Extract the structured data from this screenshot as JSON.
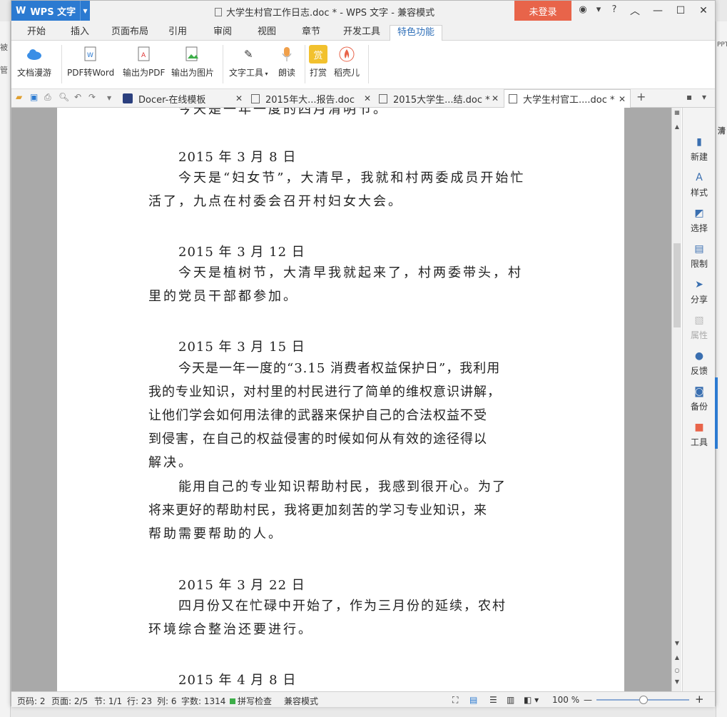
{
  "titlebar": {
    "app_name": "WPS 文字",
    "title": "大学生村官工作日志.doc * - WPS 文字 - 兼容模式",
    "login": "未登录"
  },
  "menu": [
    "开始",
    "插入",
    "页面布局",
    "引用",
    "审阅",
    "视图",
    "章节",
    "开发工具",
    "特色功能"
  ],
  "menu_active": "特色功能",
  "ribbon": {
    "buttons": [
      "文档漫游",
      "PDF转Word",
      "输出为PDF",
      "输出为图片",
      "文字工具",
      "朗读",
      "打赏",
      "稻壳儿"
    ]
  },
  "doc_tabs": [
    {
      "label": "Docer-在线模板",
      "active": false
    },
    {
      "label": "2015年大...报告.doc",
      "active": false
    },
    {
      "label": "2015大学生...结.doc *",
      "active": false
    },
    {
      "label": "大学生村官工....doc *",
      "active": true
    }
  ],
  "document": {
    "top_fragment": "今天是一年一度的四月清明节。",
    "entries": [
      {
        "date": "2015 年 3 月 8 日",
        "lines": [
          "今天是“妇女节”，大清早，我就和村两委成员开始忙",
          "活了，九点在村委会召开村妇女大会。"
        ]
      },
      {
        "date": "2015 年 3 月 12 日",
        "lines": [
          "今天是植树节，大清早我就起来了，村两委带头，村",
          "里的党员干部都参加。"
        ]
      },
      {
        "date": "2015 年 3 月 15 日",
        "lines": [
          "今天是一年一度的“3.15 消费者权益保护日”，我利用",
          "我的专业知识，对村里的村民进行了简单的维权意识讲解，",
          "让他们学会如何用法律的武器来保护自己的合法权益不受",
          "到侵害，在自己的权益侵害的时候如何从有效的途径得以",
          "解决。",
          "能用自己的专业知识帮助村民，我感到很开心。为了",
          "将来更好的帮助村民，我将更加刻苦的学习专业知识，来",
          "帮助需要帮助的人。"
        ]
      },
      {
        "date": "2015 年 3 月 22 日",
        "lines": [
          "四月份又在忙碌中开始了，作为三月份的延续，农村",
          "环境综合整治还要进行。"
        ]
      },
      {
        "date": "2015 年 4 月 8 日",
        "lines": []
      }
    ]
  },
  "side_panel": [
    "新建",
    "样式",
    "选择",
    "限制",
    "分享",
    "属性",
    "反馈",
    "备份",
    "工具"
  ],
  "status": {
    "page_num": "页码: 2",
    "page_of": "页面: 2/5",
    "section": "节: 1/1",
    "row": "行: 23",
    "col": "列: 6",
    "word_count": "字数: 1314",
    "spell": "拼写检查",
    "compat": "兼容模式",
    "zoom": "100 %"
  },
  "desktop_fragments": [
    "被",
    "管",
    "PPT",
    "清"
  ]
}
